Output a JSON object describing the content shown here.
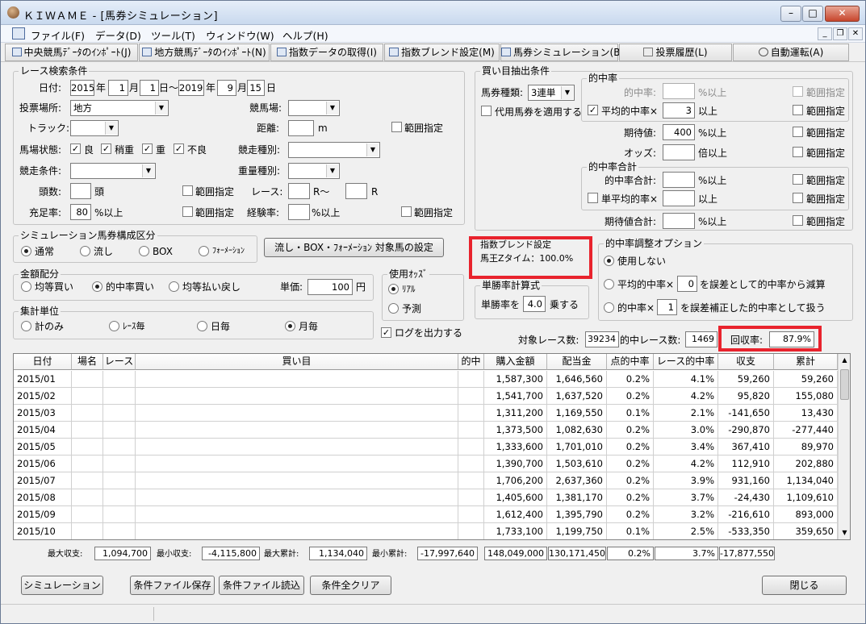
{
  "window": {
    "title": "ＫＩＷＡＭＥ - [馬券シミュレーション]",
    "controls": {
      "minimize": "–",
      "maximize": "□",
      "close": "✕"
    },
    "mdi_controls": {
      "minimize": "_",
      "restore": "❐",
      "close": "✕"
    }
  },
  "menu": {
    "items": [
      "ファイル(F)",
      "データ(D)",
      "ツール(T)",
      "ウィンドウ(W)",
      "ヘルプ(H)"
    ]
  },
  "toolbar": {
    "buttons": [
      "中央競馬ﾃﾞｰﾀのｲﾝﾎﾟｰﾄ(J)",
      "地方競馬ﾃﾞｰﾀのｲﾝﾎﾟｰﾄ(N)",
      "指数データの取得(I)",
      "指数ブレンド設定(M)",
      "馬券シミュレーション(B)",
      "投票履歴(L)",
      "自動運転(A)"
    ]
  },
  "race_search": {
    "title": "レース検索条件",
    "date_label": "日付:",
    "from_year": "2015",
    "year_unit": "年",
    "from_month": "1",
    "month_unit": "月",
    "from_day": "1",
    "day_unit_tilde": "日〜",
    "to_year": "2019",
    "to_month": "9",
    "to_day": "15",
    "day_unit": "日",
    "venue_label": "投票場所:",
    "venue_value": "地方",
    "track_label": "競馬場:",
    "track2_label": "トラック:",
    "distance_label": "距離:",
    "distance_unit": "m",
    "range_label": "範囲指定",
    "condition_label": "馬場状態:",
    "cond_good": "良",
    "cond_slight": "稍重",
    "cond_heavy": "重",
    "cond_bad": "不良",
    "race_type_label": "競走種別:",
    "race_cond_label": "競走条件:",
    "weight_label": "重量種別:",
    "heads_label": "頭数:",
    "heads_unit": "頭",
    "race_label": "レース:",
    "race_r_tilde": "R〜",
    "race_r": "R",
    "fill_label": "充足率:",
    "fill_value": "80",
    "fill_unit": "%以上",
    "exp_label": "経験率:",
    "exp_unit": "%以上"
  },
  "sim_config": {
    "title": "シミュレーション馬券構成区分",
    "options": [
      "通常",
      "流し",
      "BOX",
      "ﾌｫｰﾒｰｼｮﾝ"
    ],
    "selected": "通常",
    "target_button": "流し・BOX・ﾌｫｰﾒｰｼｮﾝ 対象馬の設定"
  },
  "money": {
    "title": "金額配分",
    "options": [
      "均等買い",
      "的中率買い",
      "均等払い戻し"
    ],
    "selected": "的中率買い",
    "unit_label": "単価:",
    "unit_value": "100",
    "yen": "円"
  },
  "odds": {
    "title": "使用ｵｯｽﾞ",
    "options": [
      "ﾘｱﾙ",
      "予測"
    ],
    "selected": "ﾘｱﾙ"
  },
  "aggregate": {
    "title": "集計単位",
    "options": [
      "計のみ",
      "ﾚｰｽ毎",
      "日毎",
      "月毎"
    ],
    "selected": "月毎"
  },
  "log_output": "ログを出力する",
  "buy_conditions": {
    "title": "買い目抽出条件",
    "ticket_type_label": "馬券種類:",
    "ticket_type_value": "3連単",
    "substitute_label": "代用馬券を適用する",
    "hit_rate_title": "的中率",
    "hit_rate_label": "的中率:",
    "pct_above": "%以上",
    "above": "以上",
    "avg_hit_label": "平均的中率×",
    "avg_hit_value": "3",
    "expected_label": "期待値:",
    "expected_value": "400",
    "odds_label": "オッズ:",
    "odds_unit": "倍以上",
    "hit_total_title": "的中率合計",
    "hit_total_label": "的中率合計:",
    "single_avg_label": "単平均的率×",
    "expected_total_label": "期待値合計:",
    "range_label": "範囲指定"
  },
  "blend": {
    "title": "指数ブレンド設定",
    "value": "馬王Zタイム：100.0%"
  },
  "win_rate": {
    "title": "単勝率計算式",
    "label": "単勝率を",
    "value": "4.0",
    "suffix": "乗する"
  },
  "hit_adjust": {
    "title": "的中率調整オプション",
    "options": [
      "使用しない",
      "平均的中率×",
      "的中率×"
    ],
    "selected": "使用しない",
    "opt2_value": "0",
    "opt2_suffix": "を誤差として的中率から減算",
    "opt3_value": "1",
    "opt3_suffix": "を誤差補正した的中率として扱う"
  },
  "summary": {
    "target_label": "対象レース数:",
    "target_value": "39234",
    "hit_label": "的中レース数:",
    "hit_value": "1469",
    "recovery_label": "回収率:",
    "recovery_value": "87.9%"
  },
  "table": {
    "headers": [
      "日付",
      "場名",
      "レース",
      "買い目",
      "的中",
      "購入金額",
      "配当金",
      "点的中率",
      "レース的中率",
      "収支",
      "累計"
    ],
    "rows": [
      [
        "2015/01",
        "",
        "",
        "",
        "",
        "1,587,300",
        "1,646,560",
        "0.2%",
        "4.1%",
        "59,260",
        "59,260"
      ],
      [
        "2015/02",
        "",
        "",
        "",
        "",
        "1,541,700",
        "1,637,520",
        "0.2%",
        "4.2%",
        "95,820",
        "155,080"
      ],
      [
        "2015/03",
        "",
        "",
        "",
        "",
        "1,311,200",
        "1,169,550",
        "0.1%",
        "2.1%",
        "-141,650",
        "13,430"
      ],
      [
        "2015/04",
        "",
        "",
        "",
        "",
        "1,373,500",
        "1,082,630",
        "0.2%",
        "3.0%",
        "-290,870",
        "-277,440"
      ],
      [
        "2015/05",
        "",
        "",
        "",
        "",
        "1,333,600",
        "1,701,010",
        "0.2%",
        "3.4%",
        "367,410",
        "89,970"
      ],
      [
        "2015/06",
        "",
        "",
        "",
        "",
        "1,390,700",
        "1,503,610",
        "0.2%",
        "4.2%",
        "112,910",
        "202,880"
      ],
      [
        "2015/07",
        "",
        "",
        "",
        "",
        "1,706,200",
        "2,637,360",
        "0.2%",
        "3.9%",
        "931,160",
        "1,134,040"
      ],
      [
        "2015/08",
        "",
        "",
        "",
        "",
        "1,405,600",
        "1,381,170",
        "0.2%",
        "3.7%",
        "-24,430",
        "1,109,610"
      ],
      [
        "2015/09",
        "",
        "",
        "",
        "",
        "1,612,400",
        "1,395,790",
        "0.2%",
        "3.2%",
        "-216,610",
        "893,000"
      ],
      [
        "2015/10",
        "",
        "",
        "",
        "",
        "1,733,100",
        "1,199,750",
        "0.1%",
        "2.5%",
        "-533,350",
        "359,650"
      ]
    ]
  },
  "footer": {
    "max_profit_label": "最大収支:",
    "max_profit": "1,094,700",
    "min_profit_label": "最小収支:",
    "min_profit": "-4,115,800",
    "max_total_label": "最大累計:",
    "max_total": "1,134,040",
    "min_total_label": "最小累計:",
    "min_total": "-17,997,640",
    "sum_purchase": "148,049,000",
    "sum_payout": "130,171,450",
    "sum_point_rate": "0.2%",
    "sum_race_rate": "3.7%",
    "sum_profit": "-17,877,550"
  },
  "bottom_buttons": {
    "simulate": "シミュレーション",
    "save": "条件ファイル保存",
    "load": "条件ファイル読込",
    "clear": "条件全クリア",
    "close": "閉じる"
  },
  "colors": {
    "highlight": "#e8232d",
    "titlebar": "#c9d9ee"
  }
}
